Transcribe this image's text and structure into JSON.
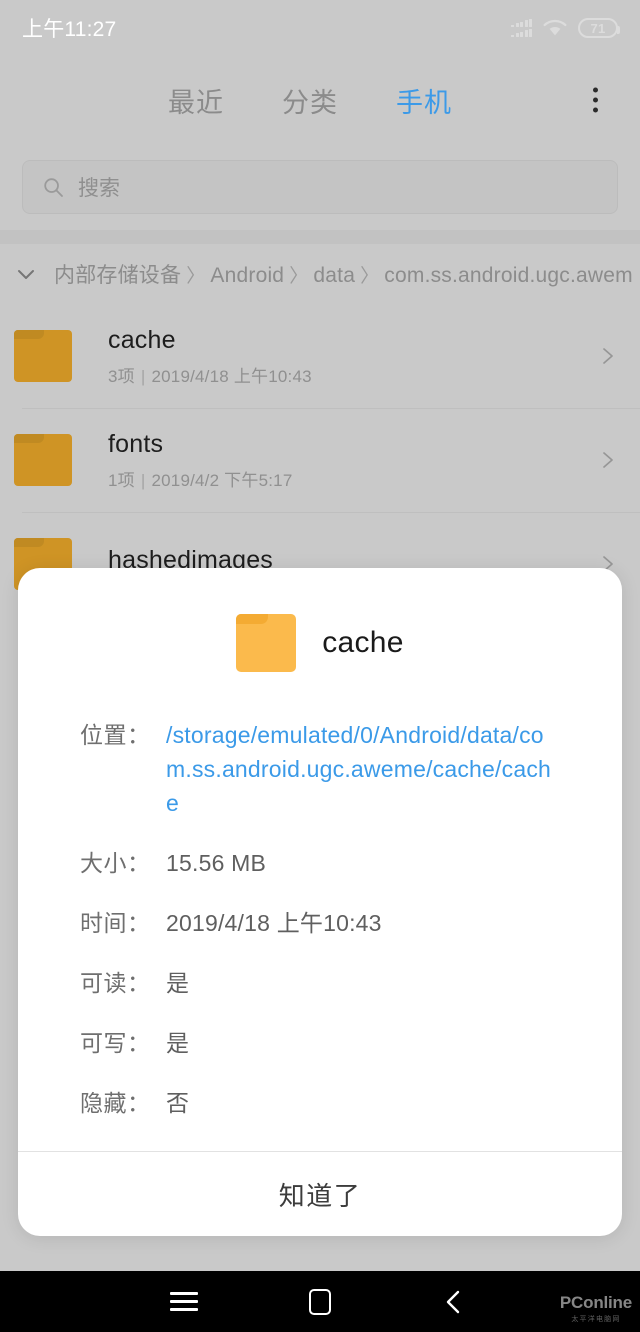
{
  "status_bar": {
    "time": "上午11:27",
    "battery_percent": "71",
    "signal_icon": "signal-bars-icon",
    "wifi_icon": "wifi-icon",
    "battery_icon": "battery-icon"
  },
  "tabs": [
    {
      "label": "最近",
      "active": false
    },
    {
      "label": "分类",
      "active": false
    },
    {
      "label": "手机",
      "active": true
    }
  ],
  "overflow_menu": {
    "icon": "more-vertical-icon"
  },
  "search": {
    "placeholder": "搜索",
    "value": "",
    "icon": "search-icon"
  },
  "breadcrumb": {
    "collapse_icon": "chevron-down-icon",
    "segments": [
      "内部存储设备",
      "Android",
      "data",
      "com.ss.android.ugc.awem"
    ],
    "separator": "〉"
  },
  "file_list": [
    {
      "name": "cache",
      "count": "3项",
      "separator": "|",
      "date": "2019/4/18 上午10:43",
      "icon": "folder-icon",
      "arrow": "chevron-right-icon"
    },
    {
      "name": "fonts",
      "count": "1项",
      "separator": "|",
      "date": "2019/4/2 下午5:17",
      "icon": "folder-icon",
      "arrow": "chevron-right-icon"
    },
    {
      "name": "hashedimages",
      "count": "",
      "separator": "",
      "date": "",
      "icon": "folder-icon",
      "arrow": "chevron-right-icon"
    }
  ],
  "dialog": {
    "title": "cache",
    "icon": "folder-icon",
    "rows": [
      {
        "label": "位置：",
        "value": "/storage/emulated/0/Android/data/com.ss.android.ugc.aweme/cache/cache",
        "is_link": true
      },
      {
        "label": "大小：",
        "value": "15.56 MB",
        "is_link": false
      },
      {
        "label": "时间：",
        "value": "2019/4/18 上午10:43",
        "is_link": false
      },
      {
        "label": "可读：",
        "value": "是",
        "is_link": false
      },
      {
        "label": "可写：",
        "value": "是",
        "is_link": false
      },
      {
        "label": "隐藏：",
        "value": "否",
        "is_link": false
      }
    ],
    "ok_button": "知道了"
  },
  "nav_bar": {
    "recents_icon": "menu-icon",
    "home_icon": "home-square-icon",
    "back_icon": "back-chevron-icon"
  },
  "watermark": {
    "main": "PConline",
    "sub": "太平洋电脑网"
  },
  "colors": {
    "accent": "#3c9ae8",
    "link": "#3b9ae8",
    "folder_dialog": "#fbba4c",
    "folder_list": "#cf9425",
    "background": "#c9c9c9"
  }
}
